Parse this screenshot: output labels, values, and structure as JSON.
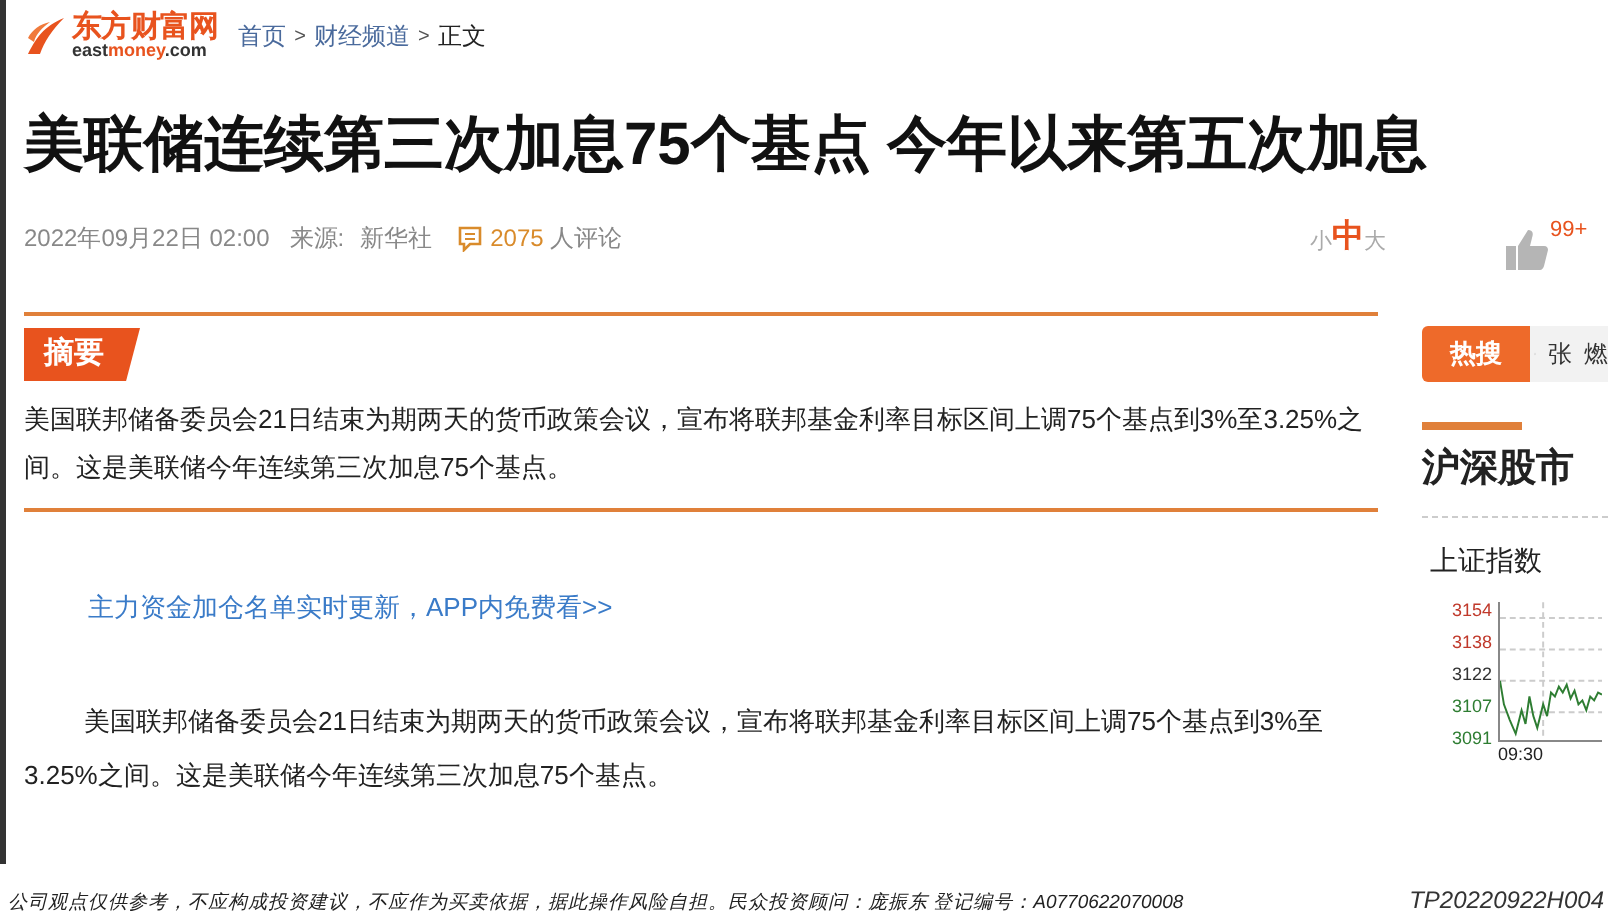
{
  "header": {
    "logo_name": "东方财富网",
    "logo_domain_parts": [
      "east",
      "money",
      ".com"
    ],
    "breadcrumb": [
      {
        "label": "首页",
        "link": true
      },
      {
        "label": "财经频道",
        "link": true
      },
      {
        "label": "正文",
        "link": false
      }
    ],
    "separator": ">"
  },
  "article": {
    "title": "美联储连续第三次加息75个基点 今年以来第五次加息",
    "date": "2022年09月22日 02:00",
    "source_label": "来源:",
    "source": "新华社",
    "comments_count": "2075",
    "comments_label": "人评论",
    "font_sizes": [
      {
        "label": "小",
        "selected": false
      },
      {
        "label": "中",
        "selected": true
      },
      {
        "label": "大",
        "selected": false
      }
    ],
    "likes": "99+",
    "summary": {
      "heading": "摘要",
      "text": "美国联邦储备委员会21日结束为期两天的货币政策会议，宣布将联邦基金利率目标区间上调75个基点到3%至3.25%之间。这是美联储今年连续第三次加息75个基点。"
    },
    "promo_link": "主力资金加仓名单实时更新，APP内免费看>>",
    "body": "美国联邦储备委员会21日结束为期两天的货币政策会议，宣布将联邦基金利率目标区间上调75个基点到3%至3.25%之间。这是美联储今年连续第三次加息75个基点。"
  },
  "sidebar": {
    "hot_search": {
      "label": "热搜",
      "items": [
        "张",
        "燃"
      ]
    },
    "market_heading": "沪深股市",
    "index_name": "上证指数",
    "chart_y_labels": [
      {
        "label": "3154",
        "color": "#c0392b"
      },
      {
        "label": "3138",
        "color": "#c0392b"
      },
      {
        "label": "3122",
        "color": "#333333"
      },
      {
        "label": "3107",
        "color": "#2e7d32"
      },
      {
        "label": "3091",
        "color": "#2e7d32"
      }
    ],
    "chart_x_label": "09:30"
  },
  "footer": {
    "disclaimer": "公司观点仅供参考，不应构成投资建议，不应作为买卖依据，据此操作风险自担。民众投资顾问：庞振东 登记编号：A0770622070008",
    "code": "TP20220922H004"
  }
}
